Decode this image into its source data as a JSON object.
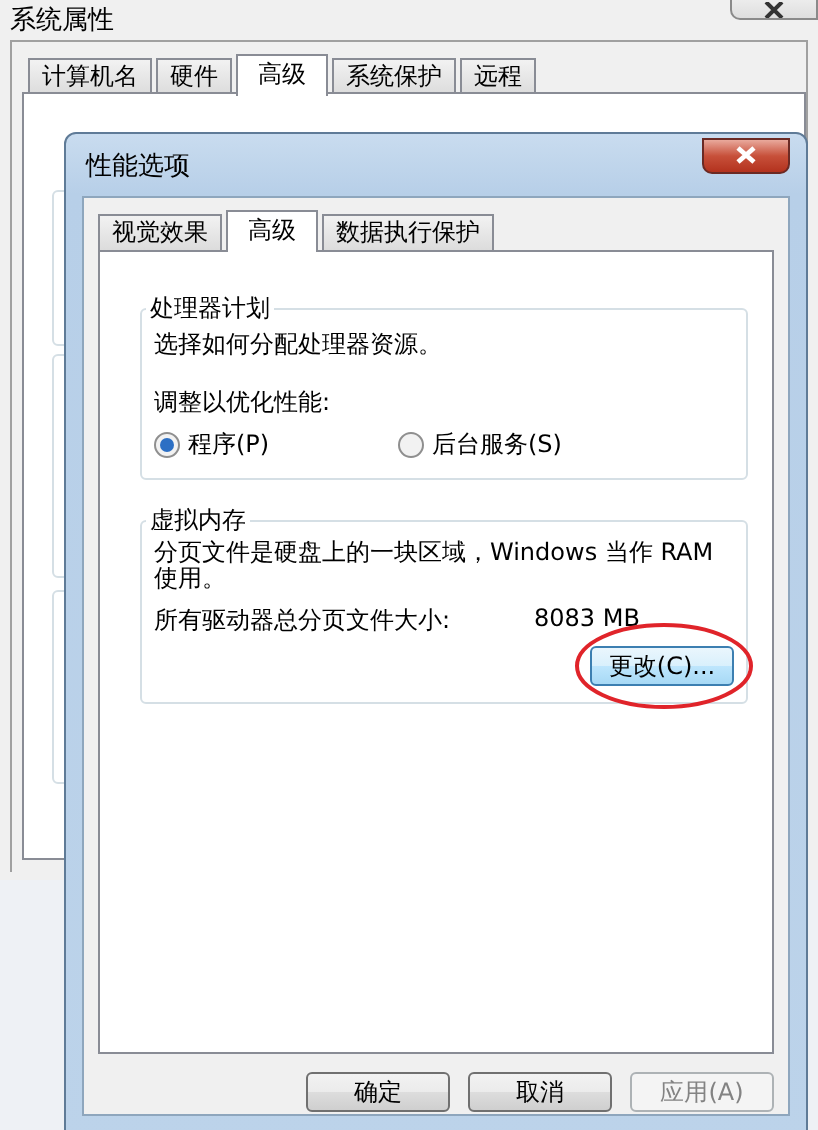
{
  "background_window": {
    "title": "系统属性",
    "tabs": [
      {
        "label": "计算机名",
        "selected": false
      },
      {
        "label": "硬件",
        "selected": false
      },
      {
        "label": "高级",
        "selected": true
      },
      {
        "label": "系统保护",
        "selected": false
      },
      {
        "label": "远程",
        "selected": false
      }
    ]
  },
  "dialog": {
    "title": "性能选项",
    "tabs": [
      {
        "label": "视觉效果",
        "selected": false
      },
      {
        "label": "高级",
        "selected": true
      },
      {
        "label": "数据执行保护",
        "selected": false
      }
    ],
    "processor_group": {
      "title": "处理器计划",
      "description": "选择如何分配处理器资源。",
      "adjust_label": "调整以优化性能:",
      "options": [
        {
          "label": "程序(P)",
          "selected": true
        },
        {
          "label": "后台服务(S)",
          "selected": false
        }
      ]
    },
    "virtual_memory_group": {
      "title": "虚拟内存",
      "description": "分页文件是硬盘上的一块区域，Windows 当作 RAM 使用。",
      "total_label": "所有驱动器总分页文件大小:",
      "total_value": "8083 MB",
      "change_button": "更改(C)...",
      "highlighted": true
    },
    "buttons": [
      {
        "label": "确定",
        "disabled": false
      },
      {
        "label": "取消",
        "disabled": false
      },
      {
        "label": "应用(A)",
        "disabled": true
      }
    ]
  }
}
